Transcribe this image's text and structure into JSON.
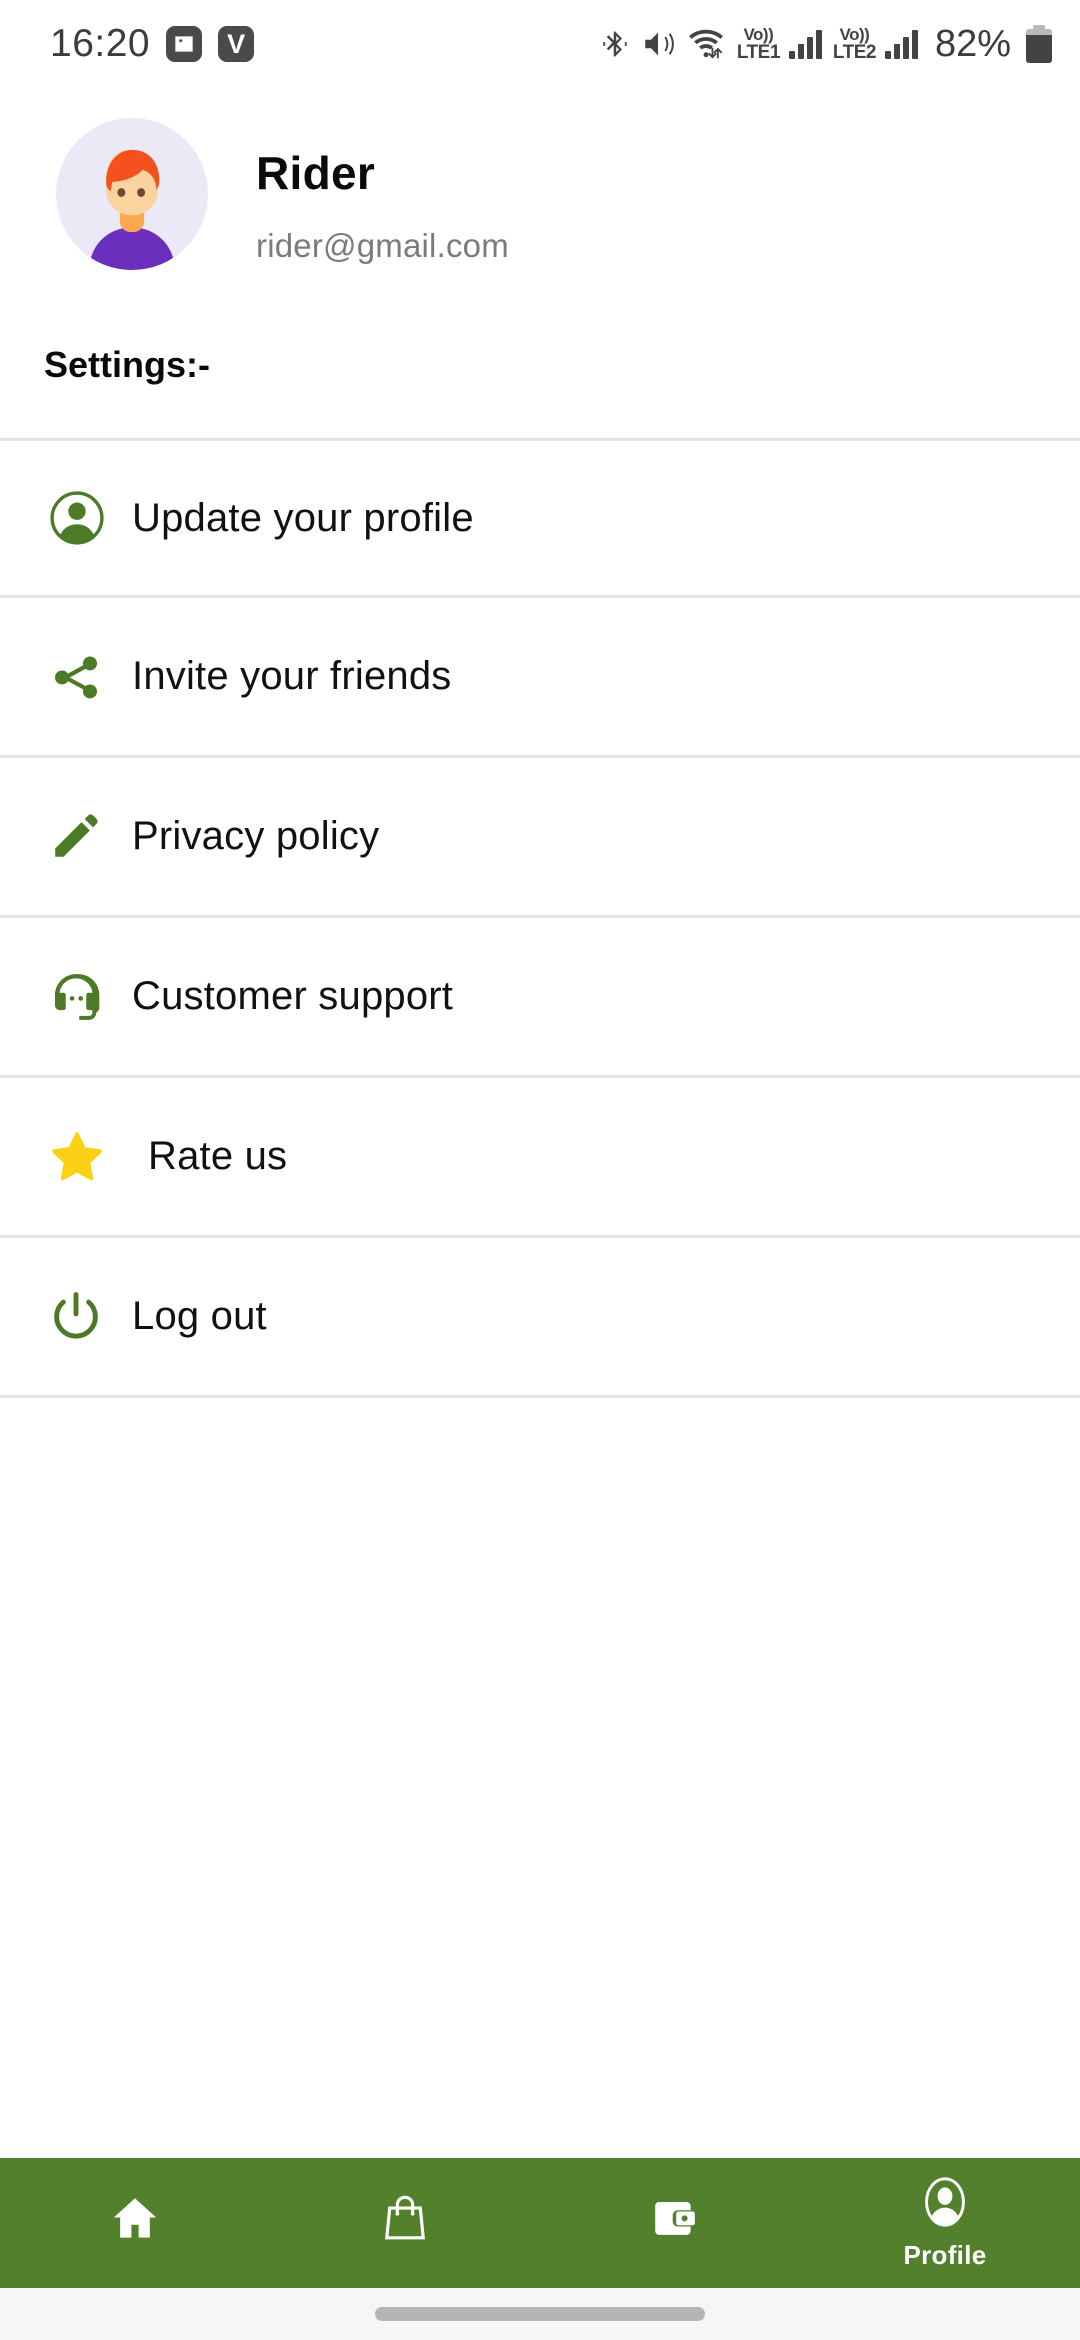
{
  "status_bar": {
    "time": "16:20",
    "notification_icons": [
      "image-icon",
      "v-app-icon"
    ],
    "v_badge_letter": "V",
    "right_icons": [
      "bluetooth-icon",
      "mute-vibrate-icon",
      "wifi-icon"
    ],
    "sim1": {
      "volte": "Vo))",
      "network": "LTE1"
    },
    "sim2": {
      "volte": "Vo))",
      "network": "LTE2"
    },
    "battery_percent": "82%"
  },
  "profile": {
    "name": "Rider",
    "email": "rider@gmail.com",
    "avatar_alt": "user-avatar"
  },
  "settings": {
    "heading": "Settings:-",
    "items": [
      {
        "label": "Update your profile",
        "icon": "person-circle-icon"
      },
      {
        "label": "Invite your friends",
        "icon": "share-icon"
      },
      {
        "label": "Privacy policy",
        "icon": "pencil-icon"
      },
      {
        "label": "Customer support",
        "icon": "headset-icon"
      },
      {
        "label": "Rate us",
        "icon": "star-icon"
      },
      {
        "label": "Log out",
        "icon": "power-icon"
      }
    ]
  },
  "bottom_nav": {
    "items": [
      {
        "label": "",
        "icon": "home-icon",
        "active": false
      },
      {
        "label": "",
        "icon": "bag-icon",
        "active": false
      },
      {
        "label": "",
        "icon": "wallet-icon",
        "active": false
      },
      {
        "label": "Profile",
        "icon": "profile-icon",
        "active": true
      }
    ]
  },
  "colors": {
    "accent_green": "#53802c",
    "icon_green": "#4c7a26",
    "star_yellow": "#fbd115",
    "divider": "#e3e3e3",
    "email_gray": "#7b7b7b",
    "avatar_bg": "#ece9f6",
    "avatar_hair": "#f4511e",
    "avatar_skin": "#fcd29f",
    "avatar_shirt": "#6a2fbd"
  }
}
